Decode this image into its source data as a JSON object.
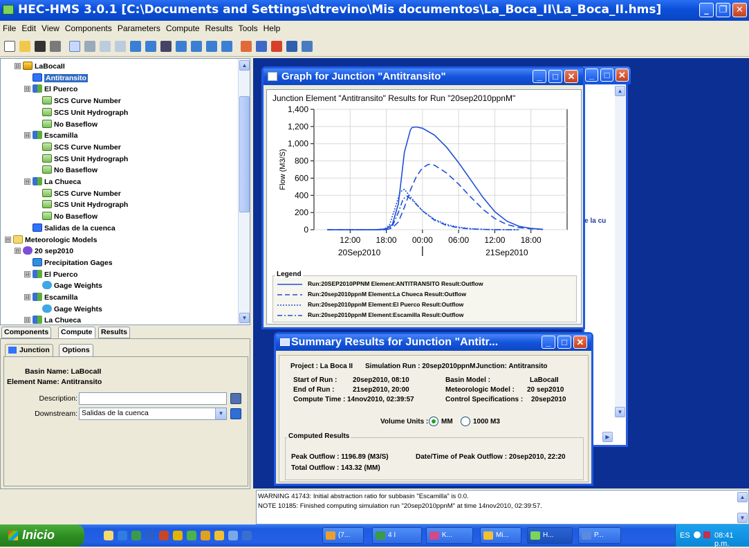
{
  "window": {
    "title": "HEC-HMS 3.0.1 [C:\\Documents and Settings\\dtrevino\\Mis documentos\\La_Boca_II\\La_Boca_II.hms]"
  },
  "menu": [
    "File",
    "Edit",
    "View",
    "Components",
    "Parameters",
    "Compute",
    "Results",
    "Tools",
    "Help"
  ],
  "tree": {
    "items": [
      {
        "label": "LaBocaII",
        "icon": "basin-model-icon",
        "level": 1,
        "expander": "⊟"
      },
      {
        "label": "Antitransito",
        "icon": "junction-icon",
        "level": 2,
        "expander": "",
        "selected": true
      },
      {
        "label": "El Puerco",
        "icon": "subbasin-icon",
        "level": 2,
        "expander": "⊟"
      },
      {
        "label": "SCS Curve Number",
        "icon": "method-icon",
        "level": 3,
        "expander": ""
      },
      {
        "label": "SCS Unit Hydrograph",
        "icon": "method-icon",
        "level": 3,
        "expander": ""
      },
      {
        "label": "No Baseflow",
        "icon": "method-icon",
        "level": 3,
        "expander": ""
      },
      {
        "label": "Escamilla",
        "icon": "subbasin-icon",
        "level": 2,
        "expander": "⊟"
      },
      {
        "label": "SCS Curve Number",
        "icon": "method-icon",
        "level": 3,
        "expander": ""
      },
      {
        "label": "SCS Unit Hydrograph",
        "icon": "method-icon",
        "level": 3,
        "expander": ""
      },
      {
        "label": "No Baseflow",
        "icon": "method-icon",
        "level": 3,
        "expander": ""
      },
      {
        "label": "La Chueca",
        "icon": "subbasin-icon",
        "level": 2,
        "expander": "⊟"
      },
      {
        "label": "SCS Curve Number",
        "icon": "method-icon",
        "level": 3,
        "expander": ""
      },
      {
        "label": "SCS Unit Hydrograph",
        "icon": "method-icon",
        "level": 3,
        "expander": ""
      },
      {
        "label": "No Baseflow",
        "icon": "method-icon",
        "level": 3,
        "expander": ""
      },
      {
        "label": "Salidas de la cuenca",
        "icon": "junction-icon",
        "level": 2,
        "expander": ""
      },
      {
        "label": "Meteorologic Models",
        "icon": "folder-icon",
        "level": 0,
        "expander": "⊟"
      },
      {
        "label": "20 sep2010",
        "icon": "met-model-icon",
        "level": 1,
        "expander": "⊟"
      },
      {
        "label": "Precipitation Gages",
        "icon": "gage-icon",
        "level": 2,
        "expander": ""
      },
      {
        "label": "El Puerco",
        "icon": "subbasin-icon",
        "level": 2,
        "expander": "⊟"
      },
      {
        "label": "Gage Weights",
        "icon": "weights-icon",
        "level": 3,
        "expander": ""
      },
      {
        "label": "Escamilla",
        "icon": "subbasin-icon",
        "level": 2,
        "expander": "⊟"
      },
      {
        "label": "Gage Weights",
        "icon": "weights-icon",
        "level": 3,
        "expander": ""
      },
      {
        "label": "La Chueca",
        "icon": "subbasin-icon",
        "level": 2,
        "expander": "⊟"
      }
    ]
  },
  "tabs": [
    "Components",
    "Compute",
    "Results"
  ],
  "props": {
    "tabs": [
      "Junction",
      "Options"
    ],
    "basin_label": "Basin Name:",
    "basin_value": "LaBocaII",
    "element_label": "Element Name:",
    "element_value": "Antitransito",
    "description_label": "Description:",
    "description_value": "",
    "downstream_label": "Downstream:",
    "downstream_value": "Salidas de la cuenca"
  },
  "graph_window": {
    "title": "Graph for Junction \"Antitransito\"",
    "header": "Junction Element \"Antitransito\" Results for Run \"20sep2010ppnM\"",
    "legend_title": "Legend",
    "bg_snippet": "de la cu"
  },
  "chart_data": {
    "type": "line",
    "ylabel": "Flow (M3/S)",
    "ylim": [
      0,
      1400
    ],
    "yticks": [
      "0",
      "200",
      "400",
      "600",
      "800",
      "1,000",
      "1,200",
      "1,400"
    ],
    "xlim_hours": [
      6,
      48
    ],
    "xticks": [
      "12:00",
      "18:00",
      "00:00",
      "06:00",
      "12:00",
      "18:00"
    ],
    "xdates": [
      "20Sep2010",
      "21Sep2010"
    ],
    "series": [
      {
        "name": "Run:20SEP2010PPNM Element:ANTITRANSITO Result:Outflow",
        "style": "solid",
        "color": "#1f4fd8",
        "x": [
          8.2,
          16,
          18,
          19,
          20,
          20.5,
          21,
          22,
          22.3,
          23,
          24,
          26,
          28,
          30,
          32,
          34,
          36,
          38,
          40,
          42,
          44
        ],
        "y": [
          0,
          0,
          10,
          60,
          300,
          600,
          900,
          1160,
          1190,
          1195,
          1180,
          1100,
          960,
          780,
          580,
          380,
          210,
          100,
          40,
          15,
          5
        ]
      },
      {
        "name": "Run:20sep2010ppnM Element:La Chueca Result:Outflow",
        "style": "dash",
        "color": "#1f4fd8",
        "x": [
          8.2,
          18,
          19,
          20,
          21,
          22,
          23,
          24,
          25,
          26,
          28,
          30,
          32,
          34,
          36,
          38,
          40,
          42,
          44
        ],
        "y": [
          0,
          0,
          20,
          90,
          260,
          460,
          620,
          720,
          760,
          750,
          660,
          530,
          380,
          240,
          130,
          60,
          25,
          10,
          3
        ]
      },
      {
        "name": "Run:20sep2010ppnM Element:El Puerco Result:Outflow",
        "style": "dot",
        "color": "#1f4fd8",
        "x": [
          8.2,
          17.5,
          18.5,
          19.5,
          20.3,
          21,
          21.8,
          23,
          24,
          26,
          28,
          30,
          32,
          34,
          36,
          38,
          40
        ],
        "y": [
          0,
          0,
          50,
          260,
          440,
          470,
          400,
          300,
          220,
          120,
          60,
          30,
          12,
          5,
          2,
          1,
          0
        ]
      },
      {
        "name": "Run:20sep2010ppnM Element:Escamilla Result:Outflow",
        "style": "dashdot",
        "color": "#1f4fd8",
        "x": [
          8.2,
          18,
          19,
          20,
          20.8,
          21.5,
          22.5,
          24,
          26,
          28,
          30,
          32,
          34,
          36,
          38,
          40
        ],
        "y": [
          0,
          0,
          40,
          200,
          360,
          390,
          330,
          220,
          110,
          50,
          22,
          9,
          3,
          1,
          0,
          0
        ]
      }
    ]
  },
  "summary_window": {
    "title": "Summary Results for Junction \"Antitr...",
    "project": "Project : La Boca II",
    "simulation_run": "Simulation Run : 20sep2010ppnM",
    "junction": "Junction: Antitransito",
    "start_label": "Start of Run :",
    "start_value": "20sep2010, 08:10",
    "end_label": "End of Run :",
    "end_value": "21sep2010, 20:00",
    "compute_label": "Compute Time :",
    "compute_value": "14nov2010, 02:39:57",
    "basin_model_label": "Basin Model :",
    "basin_model_value": "LaBocaII",
    "met_model_label": "Meteorologic Model :",
    "met_model_value": "20 sep2010",
    "control_label": "Control Specifications :",
    "control_value": "20sep2010",
    "volume_units_label": "Volume Units :",
    "volume_options": [
      "MM",
      "1000 M3"
    ],
    "computed_results_label": "Computed Results",
    "peak_outflow": "Peak Outflow : 1196.89 (M3/S)",
    "peak_datetime": "Date/Time of Peak Outflow : 20sep2010, 22:20",
    "total_outflow": "Total Outflow : 143.32 (MM)"
  },
  "messages": [
    "WARNING 41743:  Initial abstraction ratio for subbasin \"Escamilla\" is 0.0.",
    "NOTE 10185:  Finished computing simulation run \"20sep2010ppnM\" at time 14nov2010, 02:39:57."
  ],
  "taskbar": {
    "start_label": "Inicio",
    "tasks": [
      "(7...",
      "4 I",
      "K...",
      "Mi...",
      "H...",
      "P..."
    ],
    "lang": "ES",
    "clock": "08:41 p.m."
  }
}
